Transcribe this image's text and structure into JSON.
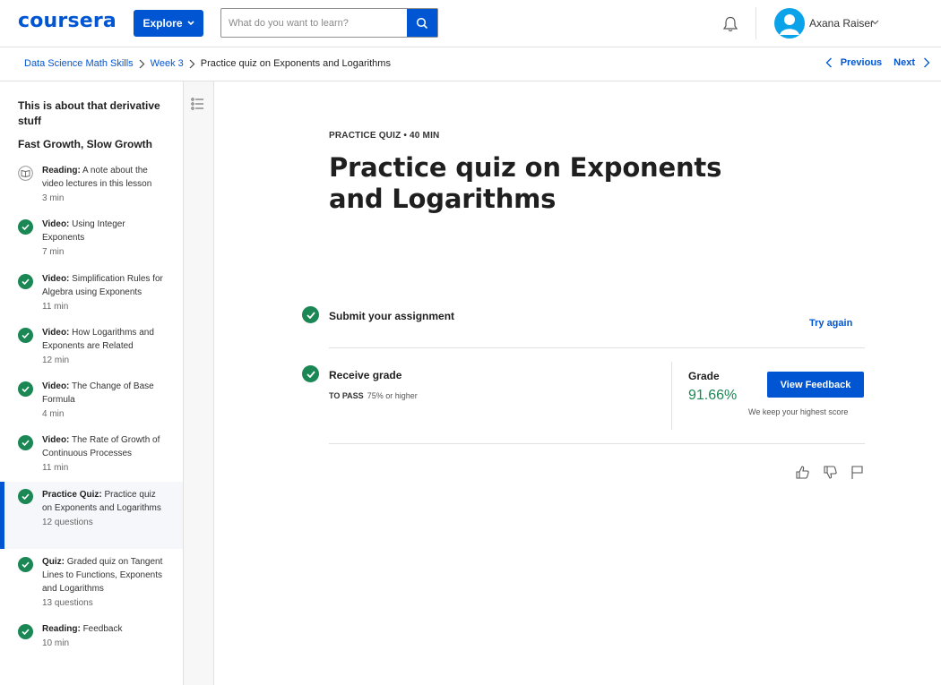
{
  "header": {
    "logo": "coursera",
    "explore_label": "Explore",
    "search_placeholder": "What do you want to learn?",
    "user_name": "Axana Raiser"
  },
  "breadcrumb": {
    "items": [
      "Data Science Math Skills",
      "Week 3"
    ],
    "current": "Practice quiz on Exponents and Logarithms",
    "previous_label": "Previous",
    "next_label": "Next"
  },
  "sidebar": {
    "module_title": "This is about that derivative stuff",
    "lesson_title": "Fast Growth, Slow Growth",
    "items": [
      {
        "type": "Reading:",
        "title": "A note about the video lectures in this lesson",
        "meta": "3 min",
        "icon": "book-icon",
        "completed": false
      },
      {
        "type": "Video:",
        "title": "Using Integer Exponents",
        "meta": "7 min",
        "icon": "check-icon",
        "completed": true
      },
      {
        "type": "Video:",
        "title": "Simplification Rules for Algebra using Exponents",
        "meta": "11 min",
        "icon": "check-icon",
        "completed": true
      },
      {
        "type": "Video:",
        "title": "How Logarithms and Exponents are Related",
        "meta": "12 min",
        "icon": "check-icon",
        "completed": true
      },
      {
        "type": "Video:",
        "title": "The Change of Base Formula",
        "meta": "4 min",
        "icon": "check-icon",
        "completed": true
      },
      {
        "type": "Video:",
        "title": "The Rate of Growth of Continuous Processes",
        "meta": "11 min",
        "icon": "check-icon",
        "completed": true
      },
      {
        "type": "Practice Quiz:",
        "title": "Practice quiz on Exponents and Logarithms",
        "meta": "12 questions",
        "icon": "check-icon",
        "completed": true,
        "active": true
      },
      {
        "type": "Quiz:",
        "title": "Graded quiz on Tangent Lines to Functions, Exponents and Logarithms",
        "meta": "13 questions",
        "icon": "check-icon",
        "completed": true
      },
      {
        "type": "Reading:",
        "title": "Feedback",
        "meta": "10 min",
        "icon": "check-icon",
        "completed": true
      }
    ]
  },
  "main": {
    "kicker": "PRACTICE QUIZ • 40 MIN",
    "title": "Practice quiz on Exponents and Logarithms",
    "submit_label": "Submit your assignment",
    "try_again_label": "Try again",
    "receive_label": "Receive grade",
    "to_pass_label": "TO PASS",
    "to_pass_value": "75% or higher",
    "grade_label": "Grade",
    "grade_value": "91.66%",
    "view_feedback_label": "View Feedback",
    "highest_note": "We keep your highest score"
  },
  "colors": {
    "brand": "#0056d2",
    "success": "#1a8754",
    "avatar": "#0aa2e8"
  }
}
